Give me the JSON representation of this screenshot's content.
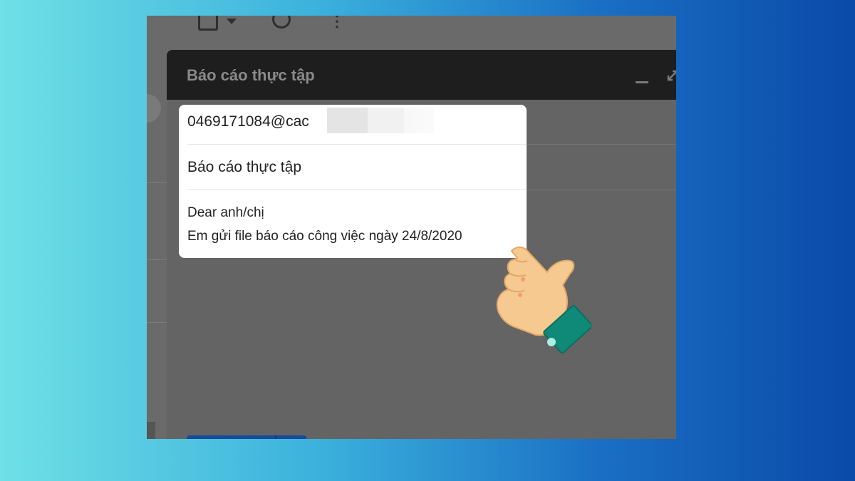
{
  "compose": {
    "title": "Báo cáo thực tập"
  },
  "email": {
    "to": "0469171084@cac",
    "subject": "Báo cáo thực tập",
    "body_line1": "Dear anh/chị",
    "body_line2": "Em gửi file báo cáo công việc ngày 24/8/2020"
  },
  "icons": {
    "toolbar": [
      "select-checkbox-icon",
      "chevron-down-icon",
      "refresh-icon",
      "more-vert-icon"
    ],
    "window": [
      "minimize-icon",
      "expand-icon"
    ],
    "overlay": "hand-pointer-icon"
  },
  "colors": {
    "background_start": "#6fe0e6",
    "background_end": "#0a4aa8",
    "compose_header": "#1e1e1e",
    "send_button": "#174a9a",
    "cuff": "#0f8a78",
    "skin": "#f5c98f"
  }
}
